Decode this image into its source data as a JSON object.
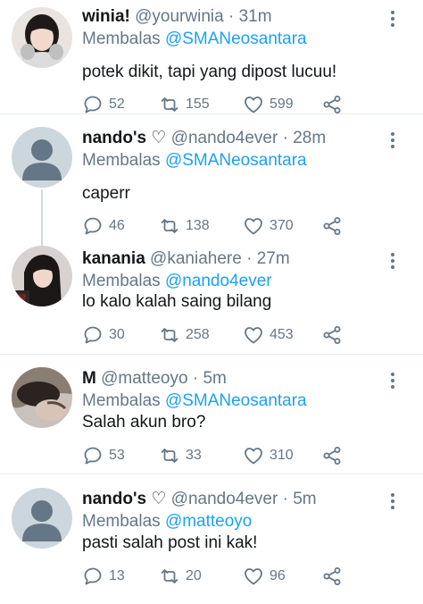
{
  "reply_prefix": "Membalas",
  "colors": {
    "link": "#1da1f2",
    "muted": "#657786",
    "text": "#14171a",
    "divider": "#e6ecf0"
  },
  "icons": {
    "reply": "comment-bubble-icon",
    "retweet": "retweet-icon",
    "like": "heart-icon",
    "share": "share-icon",
    "menu": "more-vertical-icon"
  },
  "tweets": [
    {
      "name": "winia!",
      "handle": "@yourwinia",
      "dot": "·",
      "time": "31m",
      "reply_to": "@SMANeosantara",
      "text": "potek dikit, tapi yang dipost lucuu!",
      "replies": "52",
      "retweets": "155",
      "likes": "599"
    },
    {
      "name": "nando's ♡",
      "handle": "@nando4ever",
      "dot": "·",
      "time": "28m",
      "reply_to": "@SMANeosantara",
      "text": "caperr",
      "replies": "46",
      "retweets": "138",
      "likes": "370"
    },
    {
      "name": "kanania",
      "handle": "@kaniahere",
      "dot": "·",
      "time": "27m",
      "reply_to": "@nando4ever",
      "text": "lo kalo kalah saing bilang",
      "replies": "30",
      "retweets": "258",
      "likes": "453"
    },
    {
      "name": "M",
      "handle": "@matteoyo",
      "dot": "·",
      "time": "5m",
      "reply_to": "@SMANeosantara",
      "text": "Salah akun bro?",
      "replies": "53",
      "retweets": "33",
      "likes": "310"
    },
    {
      "name": "nando's ♡",
      "handle": "@nando4ever",
      "dot": "·",
      "time": "5m",
      "reply_to": "@matteoyo",
      "text": "pasti salah post ini kak!",
      "replies": "13",
      "retweets": "20",
      "likes": "96"
    }
  ]
}
